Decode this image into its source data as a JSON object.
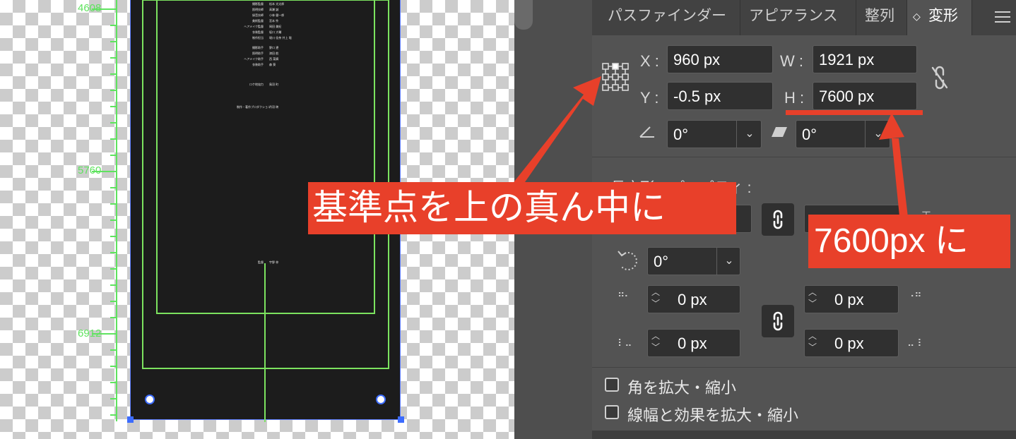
{
  "ruler": {
    "labels": [
      "4608",
      "5760",
      "6912"
    ]
  },
  "artboard": {
    "credits": [
      [
        "撮影監督",
        "松本 光太郎"
      ],
      [
        "照明技師",
        "高瀬 誠"
      ],
      [
        "録音技師",
        "小林 健一郎"
      ],
      [
        "美術監督",
        "宮本 怜"
      ],
      [
        "ヘアメイク監督",
        "岡田 美紀"
      ],
      [
        "衣装監督",
        "坂口 大輔"
      ],
      [
        "制作担当",
        "堀川 佳奈 井上 聡"
      ],
      [
        "撮影助手",
        "野口 遼"
      ],
      [
        "照明助手",
        "津田 航"
      ],
      [
        "ヘアメイク助手",
        "西 菜摘"
      ],
      [
        "衣装助手",
        "森 葵"
      ],
      [
        "ロケ地協力",
        "鳥羽 町"
      ],
      [
        "制作・著作プロダクション",
        "丹羽 映"
      ],
      [
        "監督",
        "宇野 梓"
      ]
    ]
  },
  "panel": {
    "tabs": [
      "パスファインダー",
      "アピアランス",
      "整列",
      "変形"
    ],
    "active_tab": "変形",
    "transform": {
      "x_label": "X :",
      "x_value": "960 px",
      "y_label": "Y :",
      "y_value": "-0.5 px",
      "w_label": "W :",
      "w_value": "1921 px",
      "h_label": "H :",
      "h_value": "7600 px",
      "rotate_value": "0°",
      "shear_value": "0°"
    },
    "rect_props_label": "長方形のプロパティ :",
    "corner": {
      "rotation": "0°",
      "tl": "0 px",
      "tr": "0 px",
      "bl": "0 px",
      "br": "0 px"
    },
    "options": {
      "scale_corners": "角を拡大・縮小",
      "scale_strokes": "線幅と効果を拡大・縮小"
    }
  },
  "annotations": {
    "reference_point": "基準点を上の真ん中に",
    "height_note": "7600px に",
    "color": "#e8402a"
  }
}
